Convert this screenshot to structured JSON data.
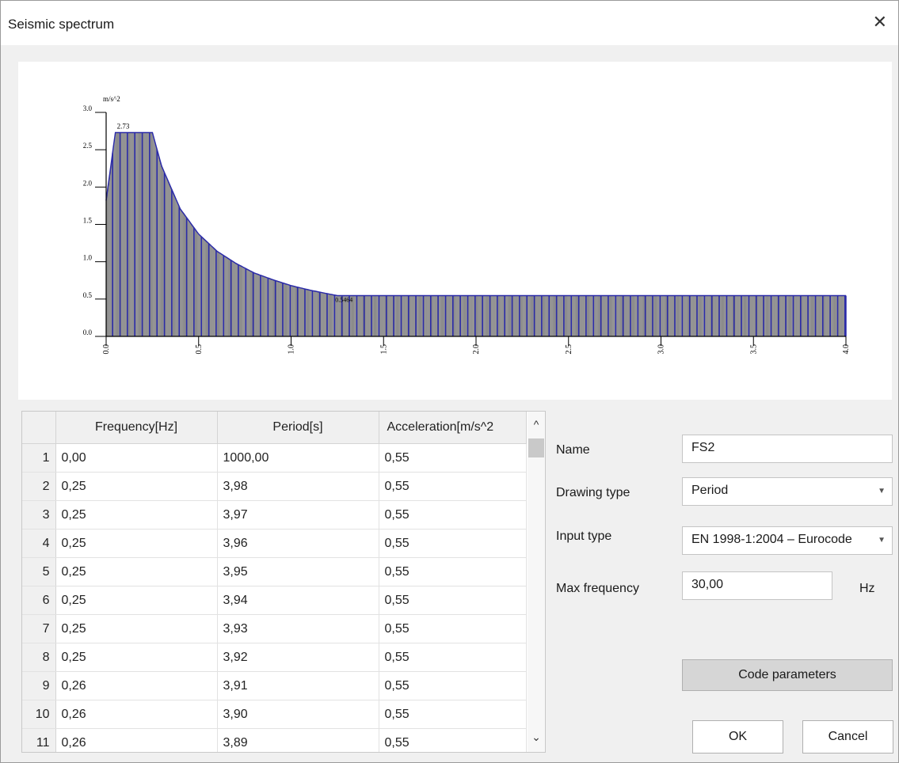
{
  "window": {
    "title": "Seismic spectrum",
    "close_glyph": "✕"
  },
  "chart_data": {
    "type": "bar",
    "ylabel": "m/s^2",
    "xlabel": "",
    "xlim": [
      0.0,
      4.0
    ],
    "ylim": [
      0.0,
      3.0
    ],
    "x_ticks": [
      "0.0",
      "0.5",
      "1.0",
      "1.5",
      "2.0",
      "2.5",
      "3.0",
      "3.5",
      "4.0"
    ],
    "y_ticks": [
      "0.0",
      "0.5",
      "1.0",
      "1.5",
      "2.0",
      "2.5",
      "3.0"
    ],
    "annotations": [
      {
        "text": "2.73",
        "x": 0.05,
        "y": 2.73
      },
      {
        "text": "0.5464",
        "x": 1.23,
        "y": 0.5464
      }
    ],
    "spectrum": [
      {
        "period": 0.0,
        "acceleration": 1.82
      },
      {
        "period": 0.05,
        "acceleration": 2.73
      },
      {
        "period": 0.25,
        "acceleration": 2.73
      },
      {
        "period": 0.3,
        "acceleration": 2.28
      },
      {
        "period": 0.4,
        "acceleration": 1.71
      },
      {
        "period": 0.5,
        "acceleration": 1.37
      },
      {
        "period": 0.6,
        "acceleration": 1.14
      },
      {
        "period": 0.7,
        "acceleration": 0.98
      },
      {
        "period": 0.8,
        "acceleration": 0.85
      },
      {
        "period": 0.9,
        "acceleration": 0.76
      },
      {
        "period": 1.0,
        "acceleration": 0.68
      },
      {
        "period": 1.1,
        "acceleration": 0.62
      },
      {
        "period": 1.2,
        "acceleration": 0.57
      },
      {
        "period": 1.25,
        "acceleration": 0.5464
      },
      {
        "period": 4.0,
        "acceleration": 0.5464
      }
    ],
    "colors": {
      "line": "#2b2ba8",
      "bars": "#2b2ba8",
      "fill": "#7a7a7a"
    }
  },
  "table": {
    "columns": [
      "Frequency[Hz]",
      "Period[s]",
      "Acceleration[m/s^2"
    ],
    "rows": [
      {
        "n": "1",
        "frequency": "0,00",
        "period": "1000,00",
        "acceleration": "0,55"
      },
      {
        "n": "2",
        "frequency": "0,25",
        "period": "3,98",
        "acceleration": "0,55"
      },
      {
        "n": "3",
        "frequency": "0,25",
        "period": "3,97",
        "acceleration": "0,55"
      },
      {
        "n": "4",
        "frequency": "0,25",
        "period": "3,96",
        "acceleration": "0,55"
      },
      {
        "n": "5",
        "frequency": "0,25",
        "period": "3,95",
        "acceleration": "0,55"
      },
      {
        "n": "6",
        "frequency": "0,25",
        "period": "3,94",
        "acceleration": "0,55"
      },
      {
        "n": "7",
        "frequency": "0,25",
        "period": "3,93",
        "acceleration": "0,55"
      },
      {
        "n": "8",
        "frequency": "0,25",
        "period": "3,92",
        "acceleration": "0,55"
      },
      {
        "n": "9",
        "frequency": "0,26",
        "period": "3,91",
        "acceleration": "0,55"
      },
      {
        "n": "10",
        "frequency": "0,26",
        "period": "3,90",
        "acceleration": "0,55"
      },
      {
        "n": "11",
        "frequency": "0,26",
        "period": "3,89",
        "acceleration": "0,55"
      }
    ],
    "scroll_up": "^",
    "scroll_down": "⌄"
  },
  "form": {
    "name_label": "Name",
    "name_value": "FS2",
    "drawing_type_label": "Drawing type",
    "drawing_type_value": "Period",
    "input_type_label": "Input type",
    "input_type_value": "EN 1998-1:2004 – Eurocode",
    "max_frequency_label": "Max frequency",
    "max_frequency_value": "30,00",
    "max_frequency_unit": "Hz",
    "dropdown_arrow": "▼"
  },
  "buttons": {
    "code_parameters": "Code parameters",
    "ok": "OK",
    "cancel": "Cancel"
  }
}
